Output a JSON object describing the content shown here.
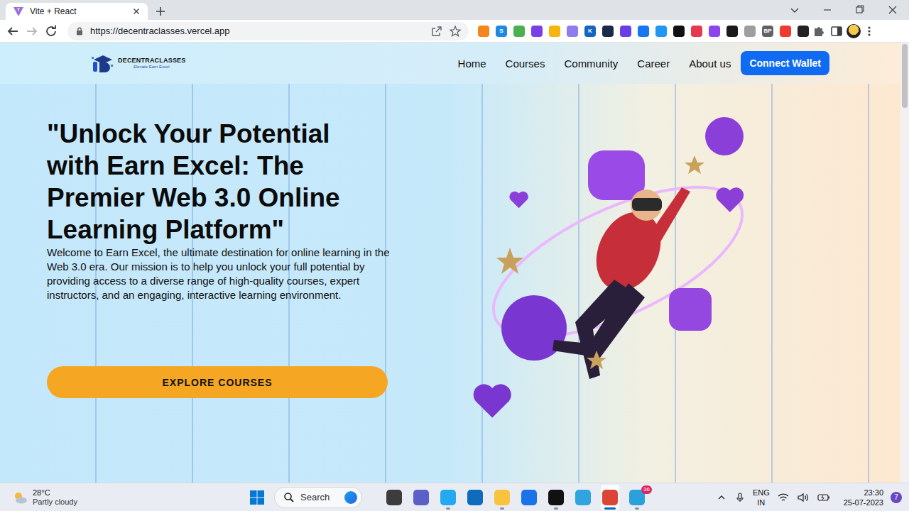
{
  "browser": {
    "tabs": [
      {
        "title": "Vite + React",
        "selected": true
      }
    ],
    "address": "https://decentraclasses.vercel.app",
    "extensions": [
      {
        "color": "#f6851b"
      },
      {
        "color": "#1e88e5",
        "label": "S"
      },
      {
        "color": "#4caf50"
      },
      {
        "color": "#7b3fe4"
      },
      {
        "color": "#f5b50a"
      },
      {
        "color": "#8e7cf0"
      },
      {
        "color": "#1565c0",
        "label": "K"
      },
      {
        "color": "#1b2a4a"
      },
      {
        "color": "#6a3de8"
      },
      {
        "color": "#1976f2"
      },
      {
        "color": "#2196f3"
      },
      {
        "color": "#111111"
      },
      {
        "color": "#e53950"
      },
      {
        "color": "#8e44ec"
      },
      {
        "color": "#1a1a1a"
      },
      {
        "color": "#9e9e9e"
      },
      {
        "color": "#5f6368",
        "label": "BP"
      },
      {
        "color": "#ef3b2d"
      },
      {
        "color": "#222222"
      }
    ]
  },
  "site": {
    "logo": {
      "name": "DECENTRACLASSES",
      "tagline": "Elevate Earn Excel"
    },
    "nav": [
      {
        "label": "Home"
      },
      {
        "label": "Courses"
      },
      {
        "label": "Community"
      },
      {
        "label": "Career"
      },
      {
        "label": "About us"
      }
    ],
    "wallet_button": "Connect Wallet",
    "hero": {
      "title": "\"Unlock Your Potential with Earn Excel: The Premier Web 3.0 Online Learning Platform\"",
      "body": "Welcome to Earn Excel, the ultimate destination for online learning in the Web 3.0 era. Our mission is to help you unlock your full potential by providing access to a diverse range of high-quality courses, expert instructors, and an engaging, interactive learning environment.",
      "button": "EXPLORE COURSES"
    }
  },
  "taskbar": {
    "weather": {
      "temp": "28°C",
      "condition": "Partly cloudy"
    },
    "search": {
      "placeholder": "Search"
    },
    "apps": [
      {
        "color": "#3c3c3c",
        "running": false,
        "selected": false
      },
      {
        "color": "#5b5fc7",
        "running": false,
        "selected": false
      },
      {
        "color": "#23a9f2",
        "running": true,
        "selected": false
      },
      {
        "color": "#0f6cbd",
        "running": false,
        "selected": false
      },
      {
        "color": "#f8c43d",
        "running": true,
        "selected": false
      },
      {
        "color": "#1a73e8",
        "running": false,
        "selected": false
      },
      {
        "color": "#111111",
        "running": true,
        "selected": false
      },
      {
        "color": "#2fa4de",
        "running": false,
        "selected": false
      },
      {
        "color": "#db4437",
        "running": true,
        "selected": true
      },
      {
        "color": "#2aa1da",
        "running": true,
        "selected": false,
        "badge": "36"
      }
    ],
    "tray": {
      "language": "ENG",
      "region": "IN",
      "time": "23:30",
      "date": "25-07-2023",
      "notifications": "7"
    }
  }
}
